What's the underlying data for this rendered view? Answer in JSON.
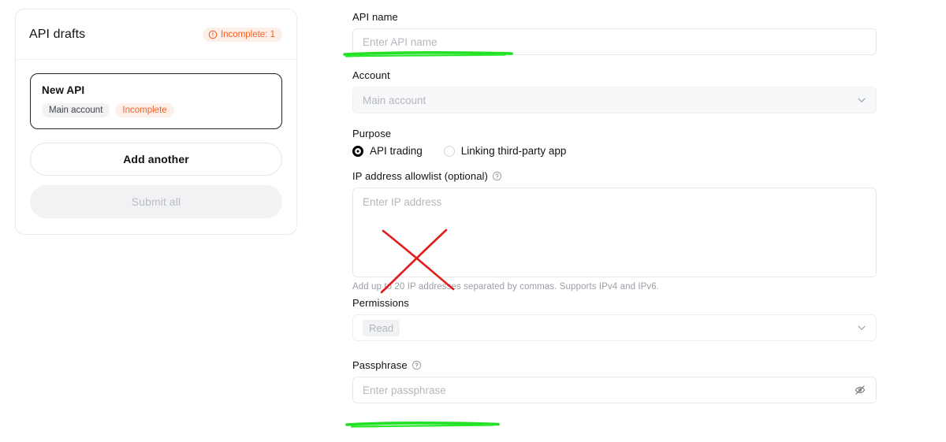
{
  "drafts_panel": {
    "title": "API drafts",
    "badge": {
      "icon": "alert-circle-icon",
      "label": "Incomplete: 1",
      "bg_color": "#fdeee7",
      "text_color": "#f0622a"
    },
    "draft_card": {
      "name": "New API",
      "chips": [
        {
          "label": "Main account",
          "variant": "neutral"
        },
        {
          "label": "Incomplete",
          "variant": "warning"
        }
      ]
    },
    "add_another_label": "Add another",
    "submit_all_label": "Submit all"
  },
  "form": {
    "api_name": {
      "label": "API name",
      "value": "",
      "placeholder": "Enter API name"
    },
    "account": {
      "label": "Account",
      "value": "Main account",
      "chevron_icon": "chevron-down-icon",
      "disabled": true
    },
    "purpose": {
      "label": "Purpose",
      "options": [
        {
          "label": "API trading",
          "selected": true
        },
        {
          "label": "Linking third-party app",
          "selected": false
        }
      ]
    },
    "ip_allowlist": {
      "label": "IP address allowlist (optional)",
      "help_icon": "question-circle-icon",
      "value": "",
      "placeholder": "Enter IP address",
      "helper_text": "Add up to 20 IP addresses separated by commas. Supports IPv4 and IPv6."
    },
    "permissions": {
      "label": "Permissions",
      "selected_tag": "Read",
      "chevron_icon": "chevron-down-icon"
    },
    "passphrase": {
      "label": "Passphrase",
      "help_icon": "question-circle-icon",
      "value": "",
      "placeholder": "Enter passphrase",
      "visibility_icon": "eye-off-icon"
    }
  },
  "annotations": {
    "green_color": "#22e024",
    "red_color": "#e01b1b",
    "marks": [
      {
        "name": "green-underline-api-name",
        "shape": "line"
      },
      {
        "name": "green-underline-passphrase",
        "shape": "line"
      },
      {
        "name": "red-cross-ip-allowlist",
        "shape": "cross"
      }
    ]
  }
}
